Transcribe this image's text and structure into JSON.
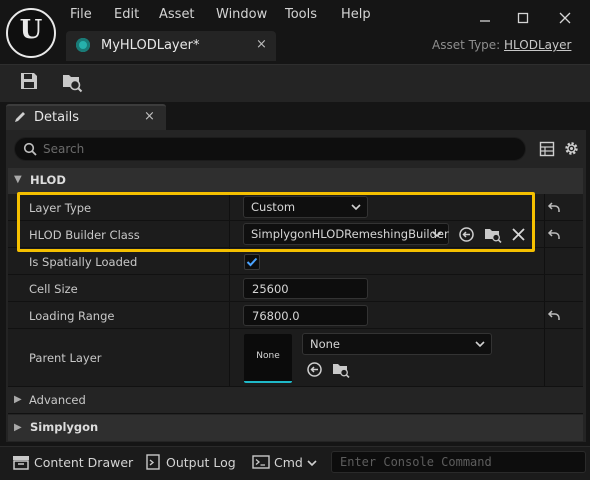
{
  "menu": [
    "File",
    "Edit",
    "Asset",
    "Window",
    "Tools",
    "Help"
  ],
  "document_tab": {
    "label": "MyHLODLayer*",
    "close": "×"
  },
  "asset_type": {
    "label": "Asset Type:",
    "value": "HLODLayer"
  },
  "details_tab": {
    "label": "Details",
    "close": "×"
  },
  "search": {
    "placeholder": "Search"
  },
  "categories": {
    "hlod": "HLOD",
    "advanced": "Advanced",
    "simplygon": "Simplygon"
  },
  "properties": {
    "layer_type": {
      "label": "Layer Type",
      "value": "Custom"
    },
    "hlod_builder_class": {
      "label": "HLOD Builder Class",
      "value": "SimplygonHLODRemeshingBuilder"
    },
    "is_spatially_loaded": {
      "label": "Is Spatially Loaded",
      "checked": true
    },
    "cell_size": {
      "label": "Cell Size",
      "value": "25600"
    },
    "loading_range": {
      "label": "Loading Range",
      "value": "76800.0"
    },
    "parent_layer": {
      "label": "Parent Layer",
      "thumbnail": "None",
      "value": "None"
    }
  },
  "bottom_bar": {
    "content_drawer": "Content Drawer",
    "output_log": "Output Log",
    "cmd": "Cmd",
    "console_placeholder": "Enter Console Command"
  },
  "colors": {
    "highlight": "#f5c000",
    "accent_cyan": "#1fb8c8",
    "checkbox_check": "#4aa3ff",
    "asset_icon": "#26b0ab"
  },
  "icons": [
    "unreal-logo",
    "asset-icon",
    "save-icon",
    "browse-asset-icon",
    "details-pencil-icon",
    "search-icon",
    "grid-icon",
    "gear-icon",
    "chevron-down-icon",
    "use-selected-icon",
    "browse-folder-icon",
    "clear-icon",
    "reset-arrow-icon",
    "content-drawer-icon",
    "output-log-icon",
    "cmd-icon"
  ]
}
